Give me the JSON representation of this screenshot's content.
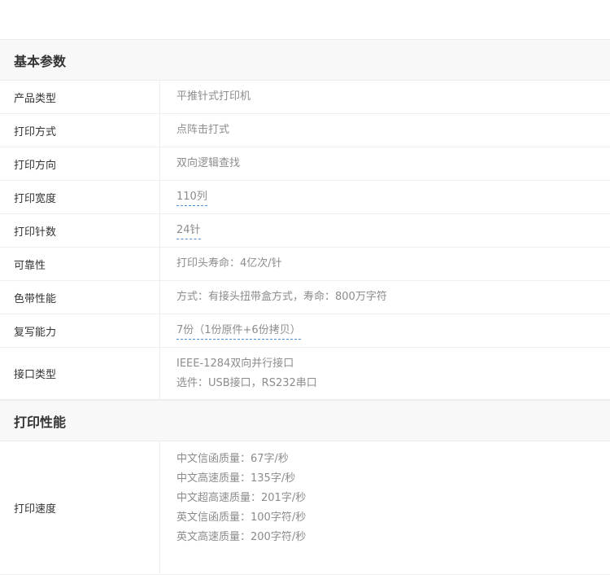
{
  "sections": [
    {
      "title": "基本参数",
      "rows": [
        {
          "label": "产品类型",
          "values": [
            "平推针式打印机"
          ],
          "link": false
        },
        {
          "label": "打印方式",
          "values": [
            "点阵击打式"
          ],
          "link": false
        },
        {
          "label": "打印方向",
          "values": [
            "双向逻辑查找"
          ],
          "link": false
        },
        {
          "label": "打印宽度",
          "values": [
            "110列"
          ],
          "link": true
        },
        {
          "label": "打印针数",
          "values": [
            "24针"
          ],
          "link": true
        },
        {
          "label": "可靠性",
          "values": [
            "打印头寿命：4亿次/针"
          ],
          "link": false
        },
        {
          "label": "色带性能",
          "values": [
            "方式：有接头扭带盒方式，寿命：800万字符"
          ],
          "link": false
        },
        {
          "label": "复写能力",
          "values": [
            "7份（1份原件+6份拷贝）"
          ],
          "link": true
        },
        {
          "label": "接口类型",
          "values": [
            "IEEE-1284双向并行接口",
            "选件：USB接口，RS232串口"
          ],
          "link": false
        }
      ]
    },
    {
      "title": "打印性能",
      "rows": [
        {
          "label": "打印速度",
          "values": [
            "中文信函质量：67字/秒",
            "中文高速质量：135字/秒",
            "中文超高速质量：201字/秒",
            "英文信函质量：100字符/秒",
            "英文高速质量：200字符/秒"
          ],
          "link": false
        }
      ]
    }
  ]
}
